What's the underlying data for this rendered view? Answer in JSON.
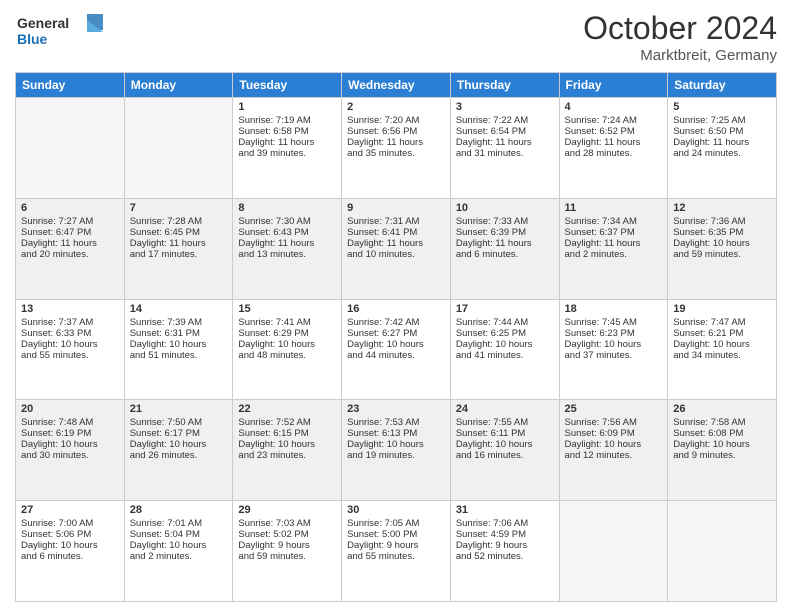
{
  "header": {
    "logo_line1": "General",
    "logo_line2": "Blue",
    "title": "October 2024",
    "subtitle": "Marktbreit, Germany"
  },
  "days_of_week": [
    "Sunday",
    "Monday",
    "Tuesday",
    "Wednesday",
    "Thursday",
    "Friday",
    "Saturday"
  ],
  "weeks": [
    {
      "shade": "white",
      "days": [
        {
          "num": "",
          "empty": true
        },
        {
          "num": "",
          "empty": true
        },
        {
          "num": "1",
          "line1": "Sunrise: 7:19 AM",
          "line2": "Sunset: 6:58 PM",
          "line3": "Daylight: 11 hours",
          "line4": "and 39 minutes."
        },
        {
          "num": "2",
          "line1": "Sunrise: 7:20 AM",
          "line2": "Sunset: 6:56 PM",
          "line3": "Daylight: 11 hours",
          "line4": "and 35 minutes."
        },
        {
          "num": "3",
          "line1": "Sunrise: 7:22 AM",
          "line2": "Sunset: 6:54 PM",
          "line3": "Daylight: 11 hours",
          "line4": "and 31 minutes."
        },
        {
          "num": "4",
          "line1": "Sunrise: 7:24 AM",
          "line2": "Sunset: 6:52 PM",
          "line3": "Daylight: 11 hours",
          "line4": "and 28 minutes."
        },
        {
          "num": "5",
          "line1": "Sunrise: 7:25 AM",
          "line2": "Sunset: 6:50 PM",
          "line3": "Daylight: 11 hours",
          "line4": "and 24 minutes."
        }
      ]
    },
    {
      "shade": "shaded",
      "days": [
        {
          "num": "6",
          "line1": "Sunrise: 7:27 AM",
          "line2": "Sunset: 6:47 PM",
          "line3": "Daylight: 11 hours",
          "line4": "and 20 minutes."
        },
        {
          "num": "7",
          "line1": "Sunrise: 7:28 AM",
          "line2": "Sunset: 6:45 PM",
          "line3": "Daylight: 11 hours",
          "line4": "and 17 minutes."
        },
        {
          "num": "8",
          "line1": "Sunrise: 7:30 AM",
          "line2": "Sunset: 6:43 PM",
          "line3": "Daylight: 11 hours",
          "line4": "and 13 minutes."
        },
        {
          "num": "9",
          "line1": "Sunrise: 7:31 AM",
          "line2": "Sunset: 6:41 PM",
          "line3": "Daylight: 11 hours",
          "line4": "and 10 minutes."
        },
        {
          "num": "10",
          "line1": "Sunrise: 7:33 AM",
          "line2": "Sunset: 6:39 PM",
          "line3": "Daylight: 11 hours",
          "line4": "and 6 minutes."
        },
        {
          "num": "11",
          "line1": "Sunrise: 7:34 AM",
          "line2": "Sunset: 6:37 PM",
          "line3": "Daylight: 11 hours",
          "line4": "and 2 minutes."
        },
        {
          "num": "12",
          "line1": "Sunrise: 7:36 AM",
          "line2": "Sunset: 6:35 PM",
          "line3": "Daylight: 10 hours",
          "line4": "and 59 minutes."
        }
      ]
    },
    {
      "shade": "white",
      "days": [
        {
          "num": "13",
          "line1": "Sunrise: 7:37 AM",
          "line2": "Sunset: 6:33 PM",
          "line3": "Daylight: 10 hours",
          "line4": "and 55 minutes."
        },
        {
          "num": "14",
          "line1": "Sunrise: 7:39 AM",
          "line2": "Sunset: 6:31 PM",
          "line3": "Daylight: 10 hours",
          "line4": "and 51 minutes."
        },
        {
          "num": "15",
          "line1": "Sunrise: 7:41 AM",
          "line2": "Sunset: 6:29 PM",
          "line3": "Daylight: 10 hours",
          "line4": "and 48 minutes."
        },
        {
          "num": "16",
          "line1": "Sunrise: 7:42 AM",
          "line2": "Sunset: 6:27 PM",
          "line3": "Daylight: 10 hours",
          "line4": "and 44 minutes."
        },
        {
          "num": "17",
          "line1": "Sunrise: 7:44 AM",
          "line2": "Sunset: 6:25 PM",
          "line3": "Daylight: 10 hours",
          "line4": "and 41 minutes."
        },
        {
          "num": "18",
          "line1": "Sunrise: 7:45 AM",
          "line2": "Sunset: 6:23 PM",
          "line3": "Daylight: 10 hours",
          "line4": "and 37 minutes."
        },
        {
          "num": "19",
          "line1": "Sunrise: 7:47 AM",
          "line2": "Sunset: 6:21 PM",
          "line3": "Daylight: 10 hours",
          "line4": "and 34 minutes."
        }
      ]
    },
    {
      "shade": "shaded",
      "days": [
        {
          "num": "20",
          "line1": "Sunrise: 7:48 AM",
          "line2": "Sunset: 6:19 PM",
          "line3": "Daylight: 10 hours",
          "line4": "and 30 minutes."
        },
        {
          "num": "21",
          "line1": "Sunrise: 7:50 AM",
          "line2": "Sunset: 6:17 PM",
          "line3": "Daylight: 10 hours",
          "line4": "and 26 minutes."
        },
        {
          "num": "22",
          "line1": "Sunrise: 7:52 AM",
          "line2": "Sunset: 6:15 PM",
          "line3": "Daylight: 10 hours",
          "line4": "and 23 minutes."
        },
        {
          "num": "23",
          "line1": "Sunrise: 7:53 AM",
          "line2": "Sunset: 6:13 PM",
          "line3": "Daylight: 10 hours",
          "line4": "and 19 minutes."
        },
        {
          "num": "24",
          "line1": "Sunrise: 7:55 AM",
          "line2": "Sunset: 6:11 PM",
          "line3": "Daylight: 10 hours",
          "line4": "and 16 minutes."
        },
        {
          "num": "25",
          "line1": "Sunrise: 7:56 AM",
          "line2": "Sunset: 6:09 PM",
          "line3": "Daylight: 10 hours",
          "line4": "and 12 minutes."
        },
        {
          "num": "26",
          "line1": "Sunrise: 7:58 AM",
          "line2": "Sunset: 6:08 PM",
          "line3": "Daylight: 10 hours",
          "line4": "and 9 minutes."
        }
      ]
    },
    {
      "shade": "white",
      "days": [
        {
          "num": "27",
          "line1": "Sunrise: 7:00 AM",
          "line2": "Sunset: 5:06 PM",
          "line3": "Daylight: 10 hours",
          "line4": "and 6 minutes."
        },
        {
          "num": "28",
          "line1": "Sunrise: 7:01 AM",
          "line2": "Sunset: 5:04 PM",
          "line3": "Daylight: 10 hours",
          "line4": "and 2 minutes."
        },
        {
          "num": "29",
          "line1": "Sunrise: 7:03 AM",
          "line2": "Sunset: 5:02 PM",
          "line3": "Daylight: 9 hours",
          "line4": "and 59 minutes."
        },
        {
          "num": "30",
          "line1": "Sunrise: 7:05 AM",
          "line2": "Sunset: 5:00 PM",
          "line3": "Daylight: 9 hours",
          "line4": "and 55 minutes."
        },
        {
          "num": "31",
          "line1": "Sunrise: 7:06 AM",
          "line2": "Sunset: 4:59 PM",
          "line3": "Daylight: 9 hours",
          "line4": "and 52 minutes."
        },
        {
          "num": "",
          "empty": true
        },
        {
          "num": "",
          "empty": true
        }
      ]
    }
  ]
}
